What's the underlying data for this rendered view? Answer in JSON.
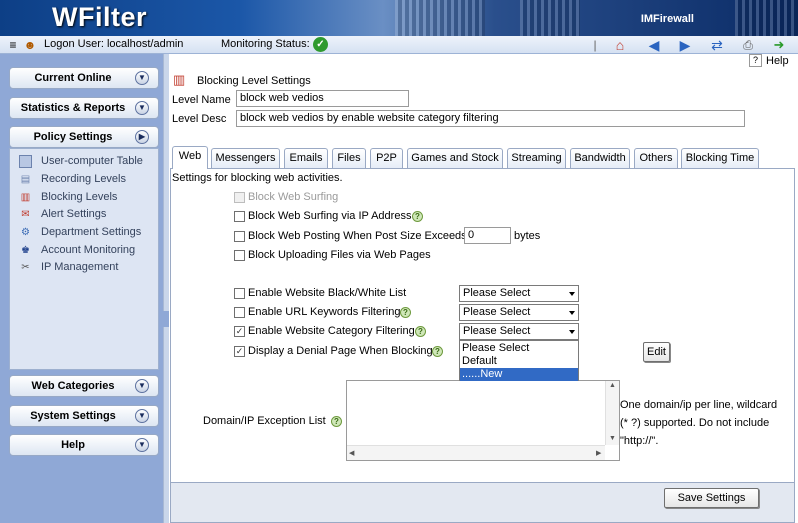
{
  "header": {
    "logo": "WFilter",
    "product": "IMFirewall"
  },
  "statusbar": {
    "logon": "Logon User: localhost/admin",
    "monitoring": "Monitoring Status:"
  },
  "sidebar": {
    "top_sections": [
      {
        "label": "Current Online"
      },
      {
        "label": "Statistics & Reports"
      },
      {
        "label": "Policy Settings"
      }
    ],
    "policy_items": [
      {
        "label": "User-computer Table",
        "icon": "table-icon"
      },
      {
        "label": "Recording Levels",
        "icon": "recording-icon"
      },
      {
        "label": "Blocking Levels",
        "icon": "blocking-icon"
      },
      {
        "label": "Alert Settings",
        "icon": "alert-icon"
      },
      {
        "label": "Department Settings",
        "icon": "department-icon"
      },
      {
        "label": "Account Monitoring",
        "icon": "account-icon"
      },
      {
        "label": "IP Management",
        "icon": "ip-icon"
      }
    ],
    "bottom_sections": [
      {
        "label": "Web Categories"
      },
      {
        "label": "System Settings"
      },
      {
        "label": "Help"
      }
    ]
  },
  "page": {
    "help": "Help",
    "title": "Blocking Level Settings",
    "level_name_label": "Level Name",
    "level_name_value": "block web vedios",
    "level_desc_label": "Level Desc",
    "level_desc_value": "block web vedios by enable website category filtering"
  },
  "tabs": [
    "Web",
    "Messengers",
    "Emails",
    "Files",
    "P2P",
    "Games and Stock",
    "Streaming",
    "Bandwidth",
    "Others",
    "Blocking Time"
  ],
  "web": {
    "intro": "Settings for blocking web activities.",
    "options": [
      {
        "label": "Block Web Surfing",
        "checked": false,
        "disabled": true
      },
      {
        "label": "Block Web Surfing via IP Address",
        "checked": false
      },
      {
        "label": "Block Web Posting When Post Size Exceeds",
        "checked": false
      },
      {
        "label": "Block Uploading Files via Web Pages",
        "checked": false
      },
      {
        "label": "Enable Website Black/White List",
        "checked": false
      },
      {
        "label": "Enable URL Keywords Filtering",
        "checked": false
      },
      {
        "label": "Enable Website Category Filtering",
        "checked": true
      },
      {
        "label": "Display a Denial Page When Blocking",
        "checked": true
      }
    ],
    "post_size_value": "0",
    "post_size_unit": "bytes",
    "select_placeholder": "Please Select",
    "dropdown_options": [
      "Please Select",
      "Default",
      "......New"
    ],
    "edit_button": "Edit",
    "exception_label": "Domain/IP Exception List",
    "exception_hint": "One domain/ip per line, wildcard (* ?) supported. Do not include \"http://\".",
    "save_button": "Save Settings"
  },
  "colors": {
    "banner": "#1b57a8",
    "sidebar": "#8fa8d6",
    "highlight": "#316ac5",
    "ok": "#2f9a2f"
  }
}
